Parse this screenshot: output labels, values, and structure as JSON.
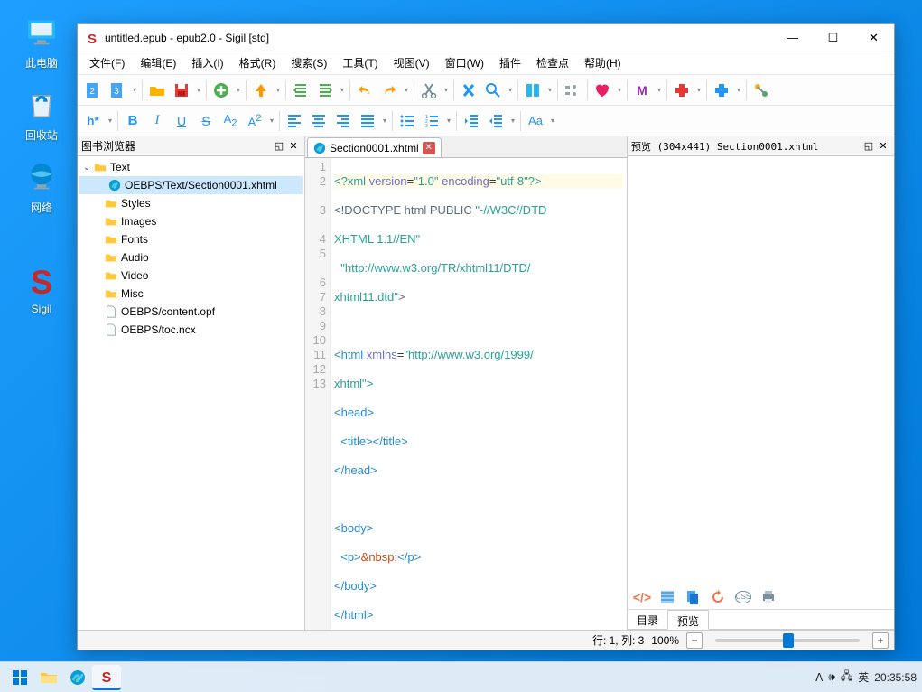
{
  "desktop": {
    "this_pc": "此电脑",
    "recycle": "回收站",
    "network": "网络",
    "sigil": "Sigil"
  },
  "window": {
    "title": "untitled.epub - epub2.0 - Sigil [std]"
  },
  "menu": {
    "file": "文件(F)",
    "edit": "编辑(E)",
    "insert": "插入(I)",
    "format": "格式(R)",
    "search": "搜索(S)",
    "tools": "工具(T)",
    "view": "视图(V)",
    "window": "窗口(W)",
    "plugins": "插件",
    "checkpoint": "检查点",
    "help": "帮助(H)"
  },
  "book_browser": {
    "title": "图书浏览器",
    "items": {
      "text": "Text",
      "section": "OEBPS/Text/Section0001.xhtml",
      "styles": "Styles",
      "images": "Images",
      "fonts": "Fonts",
      "audio": "Audio",
      "video": "Video",
      "misc": "Misc",
      "opf": "OEBPS/content.opf",
      "ncx": "OEBPS/toc.ncx"
    }
  },
  "editor": {
    "tab_name": "Section0001.xhtml",
    "lines": [
      "1",
      "2",
      "",
      "3",
      "",
      "4",
      "5",
      "",
      "6",
      "7",
      "8",
      "9",
      "10",
      "11",
      "12",
      "13"
    ],
    "code": {
      "l1": "<?xml version=\"1.0\" encoding=\"utf-8\"?>",
      "l2a": "<!DOCTYPE html PUBLIC \"-//W3C//DTD ",
      "l2b": "XHTML 1.1//EN\"",
      "l3a": "  \"http://www.w3.org/TR/xhtml11/DTD/",
      "l3b": "xhtml11.dtd\">",
      "l5a": "<html xmlns=\"http://www.w3.org/1999/",
      "l5b": "xhtml\">",
      "l6": "<head>",
      "l7": "  <title></title>",
      "l8": "</head>",
      "l10": "<body>",
      "l11": "  <p>&nbsp;</p>",
      "l12": "</body>",
      "l13": "</html>"
    }
  },
  "preview": {
    "title": "预览 (304x441) Section0001.xhtml",
    "tabs": {
      "toc": "目录",
      "preview": "预览"
    }
  },
  "status": {
    "cursor": "行: 1, 列: 3",
    "zoom": "100%"
  },
  "taskbar": {
    "ime": "英",
    "time": "20:35:58"
  },
  "colors": {
    "accent": "#0078d7",
    "folder": "#ffc83d",
    "green": "#4caf50",
    "red": "#e53935",
    "orange": "#ff9800",
    "blue_icon": "#2196f3",
    "pink": "#e91e63",
    "magenta": "#9c27b0",
    "teal": "#009688"
  }
}
